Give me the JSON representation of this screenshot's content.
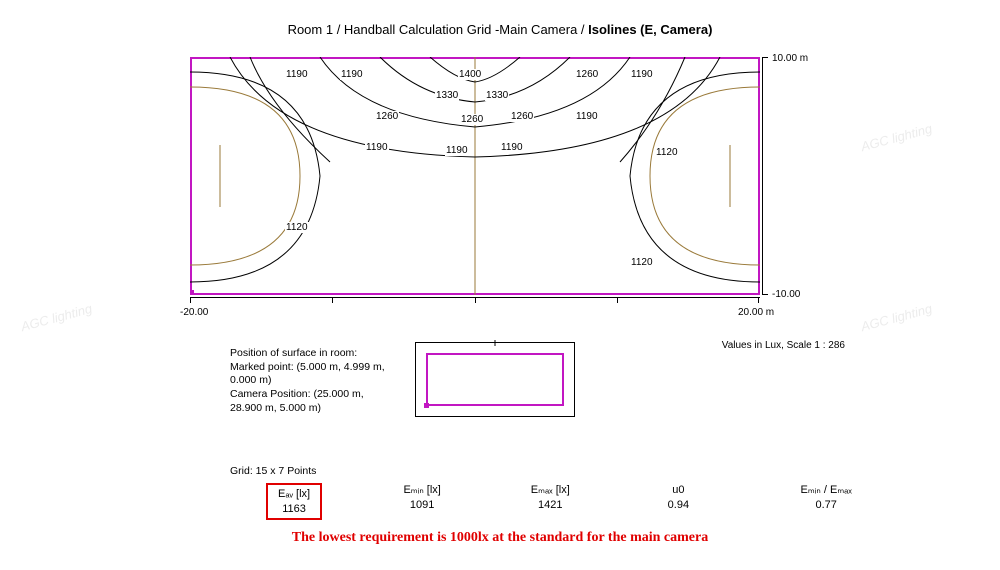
{
  "title": {
    "part1": "Room 1 / Handball Calculation Grid -Main Camera / ",
    "part2": "Isolines (E, Camera)"
  },
  "axes": {
    "y_top": "10.00 m",
    "y_bottom": "-10.00",
    "x_left": "-20.00",
    "x_right": "20.00 m"
  },
  "scale_note": "Values in Lux, Scale 1 : 286",
  "iso_labels": {
    "l1": "1190",
    "l2": "1190",
    "l3": "1400",
    "l4": "1260",
    "l5": "1190",
    "l6": "1330",
    "l7": "1330",
    "l8": "1260",
    "l9": "1260",
    "l10": "1260",
    "l11": "1190",
    "l12": "1190",
    "l13": "1190",
    "l14": "1190",
    "l15": "1120",
    "l16": "1120",
    "l17": "1120"
  },
  "info": {
    "line1": "Position of surface in room:",
    "line2": "Marked point: (5.000 m, 4.999 m,",
    "line3": "0.000 m)",
    "line4": "Camera Position: (25.000 m,",
    "line5": "28.900 m, 5.000 m)"
  },
  "grid_note": "Grid: 15 x 7 Points",
  "summary": {
    "eav_label": "Eₐᵥ [lx]",
    "eav_val": "1163",
    "emin_label": "Eₘᵢₙ [lx]",
    "emin_val": "1091",
    "emax_label": "Eₘₐₓ [lx]",
    "emax_val": "1421",
    "u0_label": "u0",
    "u0_val": "0.94",
    "ratio_label": "Eₘᵢₙ / Eₘₐₓ",
    "ratio_val": "0.77"
  },
  "footer": "The lowest requirement is 1000lx at the standard for the main camera",
  "watermark": "AGC lighting"
}
